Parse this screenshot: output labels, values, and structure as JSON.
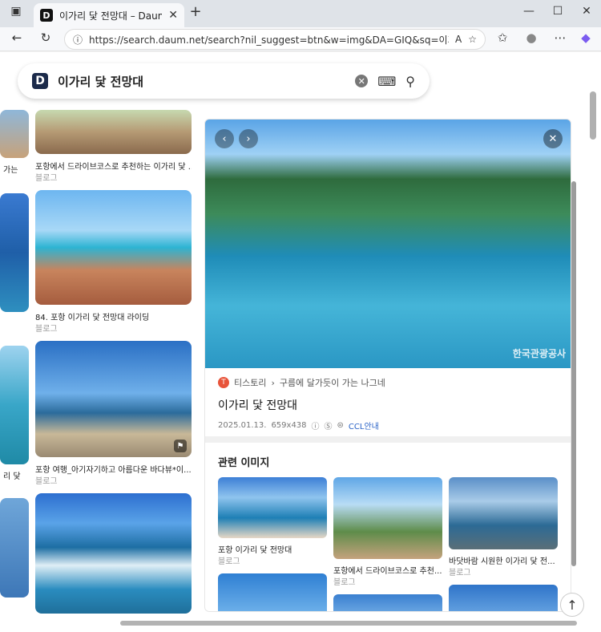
{
  "tab": {
    "title": "이가리 닻 전망대 – Daum 검색",
    "favicon": "D"
  },
  "url": "https://search.daum.net/search?nil_suggest=btn&w=img&DA=GIQ&sq=이가리&o=...",
  "search": {
    "query": "이가리 닻 전망대",
    "logo": "D"
  },
  "grid": {
    "items": [
      {
        "caption": "포항에서 드라이브코스로 추천하는 이가리 닻 ...",
        "source": "블로그"
      },
      {
        "caption": "84. 포항 이가리 닻 전망대 라이딩",
        "source": "블로그"
      },
      {
        "caption": "포항 여행_아기자기하고 아름다운 바다뷰*이...",
        "source": "블로그"
      }
    ],
    "left_partial": {
      "caption_a": "가는",
      "source_a": "",
      "caption_b": "리 닻",
      "source_b": ""
    }
  },
  "detail": {
    "source_name": "티스토리",
    "source_path": "구름에 달가듯이 가는 나그네",
    "title": "이가리 닻 전망대",
    "date": "2025.01.13.",
    "size": "659x438",
    "license": "CCL안내",
    "watermark": "한국관광공사"
  },
  "related": {
    "heading": "관련 이미지",
    "items": [
      {
        "caption": "포항 이가리 닻 전망대",
        "source": "블로그"
      },
      {
        "caption": "포항에서 드라이브코스로 추천...",
        "source": "블로그"
      },
      {
        "caption": "바닷바람 시원한 이가리 닻 전...",
        "source": "블로그"
      }
    ]
  },
  "colors": {
    "accent": "#2a63c7",
    "brand": "#1b2a4a"
  }
}
